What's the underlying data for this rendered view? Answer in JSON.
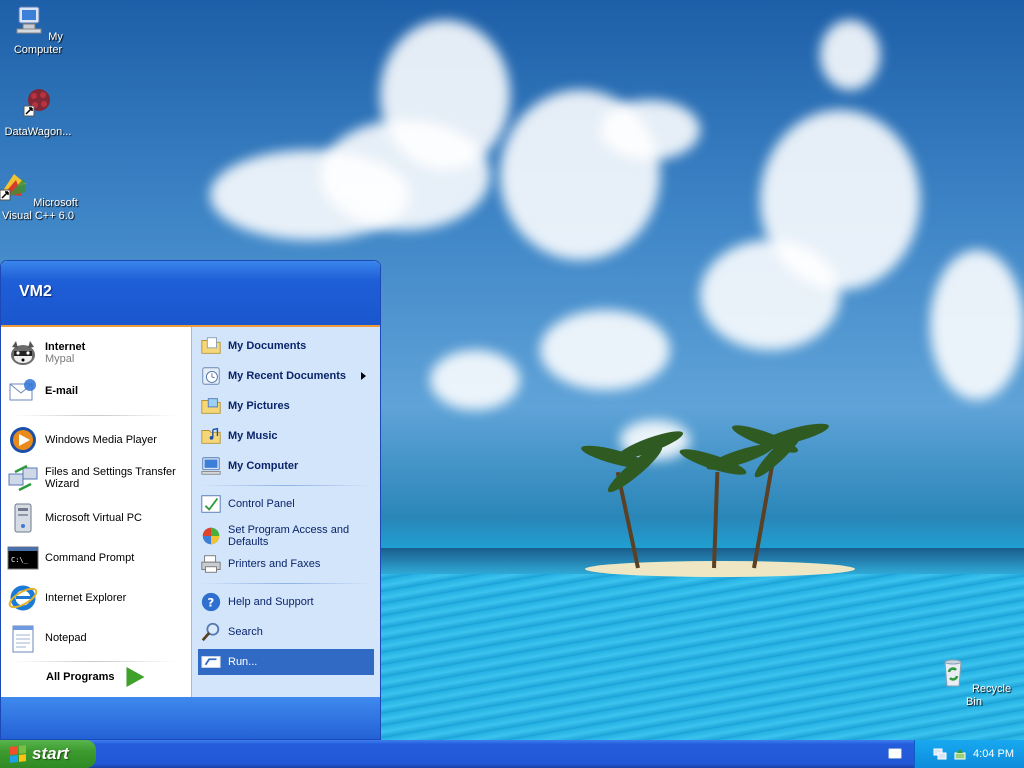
{
  "desktop": {
    "icons": [
      {
        "label": "My Computer",
        "icon": "computer-icon"
      },
      {
        "label": "DataWagon...",
        "icon": "datawagon-shortcut-icon"
      },
      {
        "label": "Microsoft Visual C++ 6.0",
        "icon": "visual-cpp-icon"
      },
      {
        "label": "Recycle Bin",
        "icon": "recycle-bin-icon"
      }
    ]
  },
  "start_menu": {
    "username": "VM2",
    "pinned": [
      {
        "label": "Internet",
        "sub": "Mypal",
        "icon": "mypal-browser-icon"
      },
      {
        "label": "E-mail",
        "icon": "email-icon"
      }
    ],
    "recent": [
      {
        "label": "Windows Media Player",
        "icon": "media-player-icon"
      },
      {
        "label": "Files and Settings Transfer Wizard",
        "icon": "transfer-wizard-icon"
      },
      {
        "label": "Microsoft Virtual PC",
        "icon": "virtual-pc-icon"
      },
      {
        "label": "Command Prompt",
        "icon": "command-prompt-icon"
      },
      {
        "label": "Internet Explorer",
        "icon": "internet-explorer-icon"
      },
      {
        "label": "Notepad",
        "icon": "notepad-icon"
      }
    ],
    "all_programs": "All Programs",
    "places": [
      {
        "label": "My Documents",
        "icon": "folder-documents-icon"
      },
      {
        "label": "My Recent Documents",
        "icon": "recent-documents-icon"
      },
      {
        "label": "My Pictures",
        "icon": "folder-pictures-icon"
      },
      {
        "label": "My Music",
        "icon": "folder-music-icon"
      },
      {
        "label": "My Computer",
        "icon": "computer-icon"
      }
    ],
    "system": [
      {
        "label": "Control Panel",
        "icon": "control-panel-icon"
      },
      {
        "label": "Set Program Access and Defaults",
        "icon": "program-defaults-icon"
      },
      {
        "label": "Printers and Faxes",
        "icon": "printer-icon"
      }
    ],
    "help": [
      {
        "label": "Help and Support",
        "icon": "help-icon"
      },
      {
        "label": "Search",
        "icon": "search-icon"
      },
      {
        "label": "Run...",
        "icon": "run-icon"
      }
    ],
    "selected_item": "Run..."
  },
  "taskbar": {
    "start_label": "start",
    "clock": "4:04 PM"
  },
  "colors": {
    "taskbar_blue": "#245edc",
    "start_green": "#3c9a2f",
    "menu_header_blue": "#1e5ed6",
    "selection_blue": "#316ac5",
    "right_column_bg": "#d3e5fa"
  }
}
